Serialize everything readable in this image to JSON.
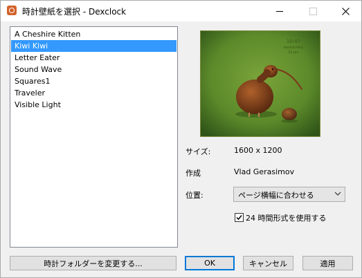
{
  "window": {
    "title": "時計壁紙を選択 - Dexclock",
    "controls": {
      "minimize_icon": "minimize-icon",
      "maximize_icon": "maximize-icon",
      "close_icon": "close-icon"
    }
  },
  "wallpaper_list": {
    "items": [
      {
        "label": "A Cheshire Kitten"
      },
      {
        "label": "Kiwi Kiwi",
        "selected": true
      },
      {
        "label": "Letter Eater"
      },
      {
        "label": "Sound Wave"
      },
      {
        "label": "Squares1"
      },
      {
        "label": "Traveler"
      },
      {
        "label": "Visible Light"
      }
    ]
  },
  "preview": {
    "clock_time": "10:47",
    "clock_day": "wednesday",
    "clock_date": "22 jan"
  },
  "details": {
    "size_label": "サイズ:",
    "size_value": "1600 x 1200",
    "author_label": "作成",
    "author_value": "Vlad Gerasimov",
    "position_label": "位置:",
    "position_value": "ページ横幅に合わせる",
    "checkbox_label": "24 時間形式を使用する",
    "checkbox_checked": true
  },
  "buttons": {
    "change_folder": "時計フォルダーを変更する...",
    "ok": "OK",
    "cancel": "キャンセル",
    "apply": "適用"
  },
  "colors": {
    "selection": "#3399ff",
    "default_button_border": "#0078d7",
    "preview_grass": "#5f8a2a"
  }
}
